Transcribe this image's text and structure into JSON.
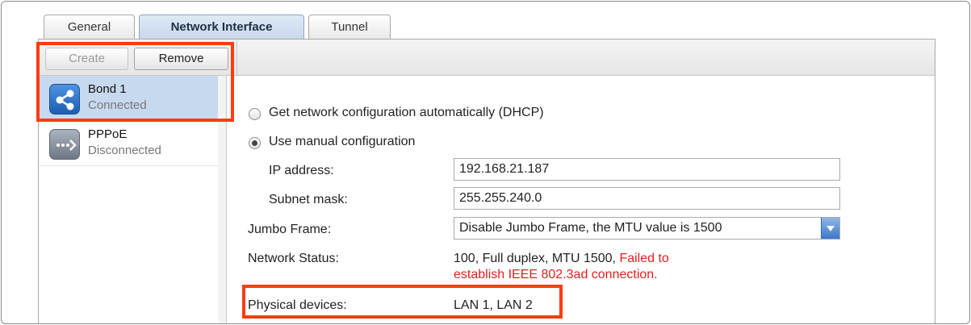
{
  "tabs": [
    {
      "label": "General"
    },
    {
      "label": "Network Interface"
    },
    {
      "label": "Tunnel"
    }
  ],
  "toolbar": {
    "create_label": "Create",
    "remove_label": "Remove"
  },
  "sidebar": {
    "items": [
      {
        "title": "Bond 1",
        "status": "Connected",
        "icon": "share-icon"
      },
      {
        "title": "PPPoE",
        "status": "Disconnected",
        "icon": "pppoe-icon"
      }
    ]
  },
  "form": {
    "dhcp_label": "Get network configuration automatically (DHCP)",
    "manual_label": "Use manual configuration",
    "ip_label": "IP address:",
    "ip_value": "192.168.21.187",
    "subnet_label": "Subnet mask:",
    "subnet_value": "255.255.240.0",
    "jumbo_label": "Jumbo Frame:",
    "jumbo_value": "Disable Jumbo Frame, the MTU value is 1500",
    "status_label": "Network Status:",
    "status_value": "100, Full duplex, MTU 1500,",
    "status_error_1": "Failed to",
    "status_error_2": "establish IEEE 802.3ad connection.",
    "physical_label": "Physical devices:",
    "physical_value": "LAN 1, LAN 2"
  },
  "colors": {
    "highlight": "#ff3b12",
    "selected": "#c7d9ef",
    "error": "#e02020"
  }
}
